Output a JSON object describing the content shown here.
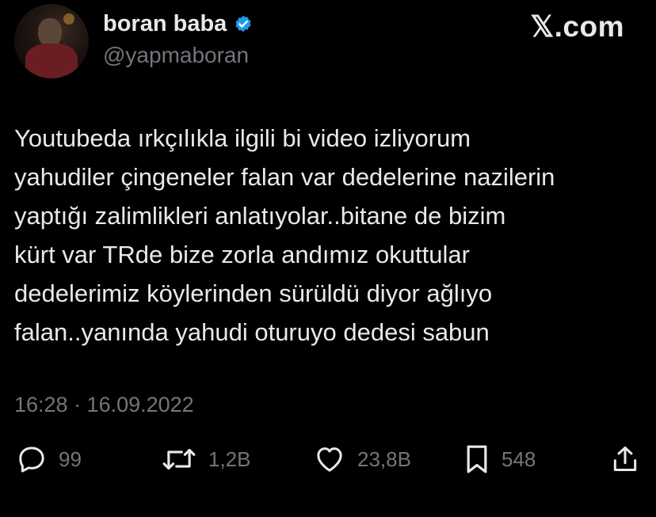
{
  "header": {
    "display_name": "boran baba",
    "handle": "@yapmaboran",
    "brand": "𝕏.com",
    "verified_color": "#1d9bf0"
  },
  "tweet": {
    "lines": [
      "Youtubeda ırkçılıkla ilgili bi video izliyorum",
      "yahudiler çingeneler falan var dedelerine nazilerin",
      "yaptığı zalimlikleri anlatıyolar..bitane de bizim",
      "kürt var TRde bize zorla andımız okuttular",
      "dedelerimiz köylerinden sürüldü diyor ağlıyo",
      "falan..yanında yahudi oturuyo dedesi sabun"
    ],
    "timestamp": "16:28 · 16.09.2022"
  },
  "actions": {
    "replies": "99",
    "retweets": "1,2B",
    "likes": "23,8B",
    "bookmarks": "548"
  }
}
